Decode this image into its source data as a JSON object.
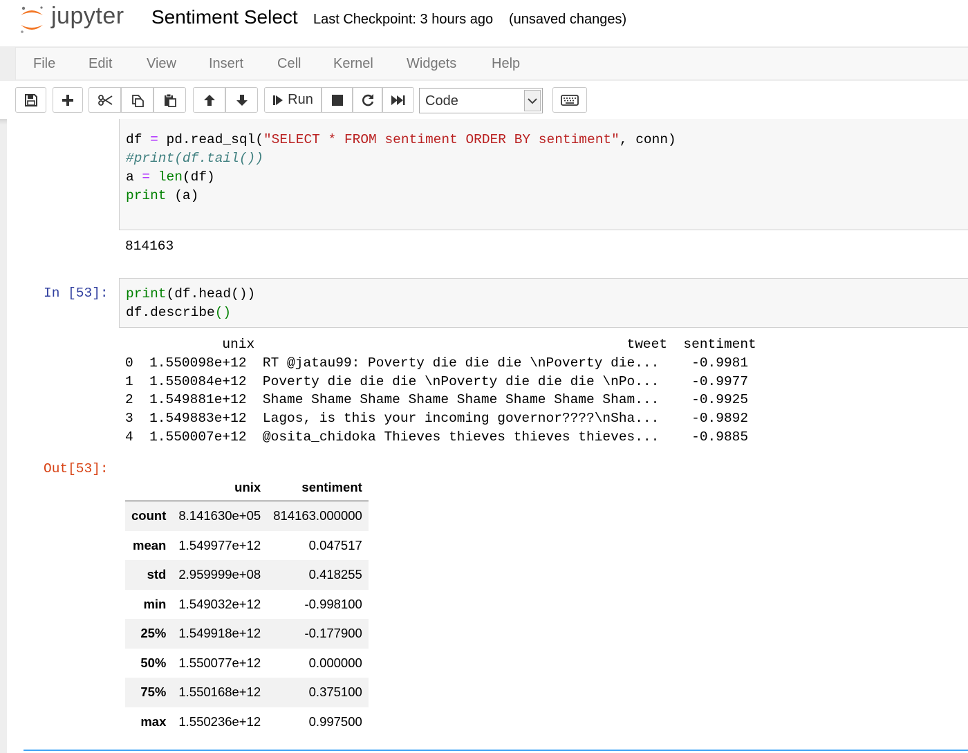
{
  "header": {
    "logo_text": "jupyter",
    "notebook_title": "Sentiment Select",
    "checkpoint": "Last Checkpoint: 3 hours ago",
    "status": "(unsaved changes)"
  },
  "menubar": {
    "items": [
      "File",
      "Edit",
      "View",
      "Insert",
      "Cell",
      "Kernel",
      "Widgets",
      "Help"
    ]
  },
  "toolbar": {
    "run_label": "Run",
    "cell_type": "Code",
    "buttons": [
      "save-icon",
      "plus-icon",
      "scissors-icon",
      "copy-icon",
      "paste-icon",
      "arrow-up-icon",
      "arrow-down-icon",
      "run-icon",
      "stop-icon",
      "restart-icon",
      "fast-forward-icon",
      "keyboard-icon"
    ]
  },
  "cells": [
    {
      "prompt": "",
      "code_lines": [
        "df = pd.read_sql(\"SELECT * FROM sentiment ORDER BY sentiment\", conn)",
        "#print(df.tail())",
        "a = len(df)",
        "print (a)"
      ],
      "output_text": "814163"
    },
    {
      "prompt": "In [53]:",
      "code_lines": [
        "print(df.head())",
        "df.describe()"
      ],
      "stdout_lines": [
        "            unix                                              tweet  sentiment",
        "0  1.550098e+12  RT @jatau99: Poverty die die die \\nPoverty die...    -0.9981",
        "1  1.550084e+12  Poverty die die die \\nPoverty die die die \\nPo...    -0.9977",
        "2  1.549881e+12  Shame Shame Shame Shame Shame Shame Shame Sham...    -0.9925",
        "3  1.549883e+12  Lagos, is this your incoming governor????\\nSha...    -0.9892",
        "4  1.550007e+12  @osita_chidoka Thieves thieves thieves thieves...    -0.9885"
      ],
      "out_prompt": "Out[53]:",
      "table": {
        "columns": [
          "",
          "unix",
          "sentiment"
        ],
        "rows": [
          [
            "count",
            "8.141630e+05",
            "814163.000000"
          ],
          [
            "mean",
            "1.549977e+12",
            "0.047517"
          ],
          [
            "std",
            "2.959999e+08",
            "0.418255"
          ],
          [
            "min",
            "1.549032e+12",
            "-0.998100"
          ],
          [
            "25%",
            "1.549918e+12",
            "-0.177900"
          ],
          [
            "50%",
            "1.550077e+12",
            "0.000000"
          ],
          [
            "75%",
            "1.550168e+12",
            "0.375100"
          ],
          [
            "max",
            "1.550236e+12",
            "0.997500"
          ]
        ]
      }
    }
  ]
}
